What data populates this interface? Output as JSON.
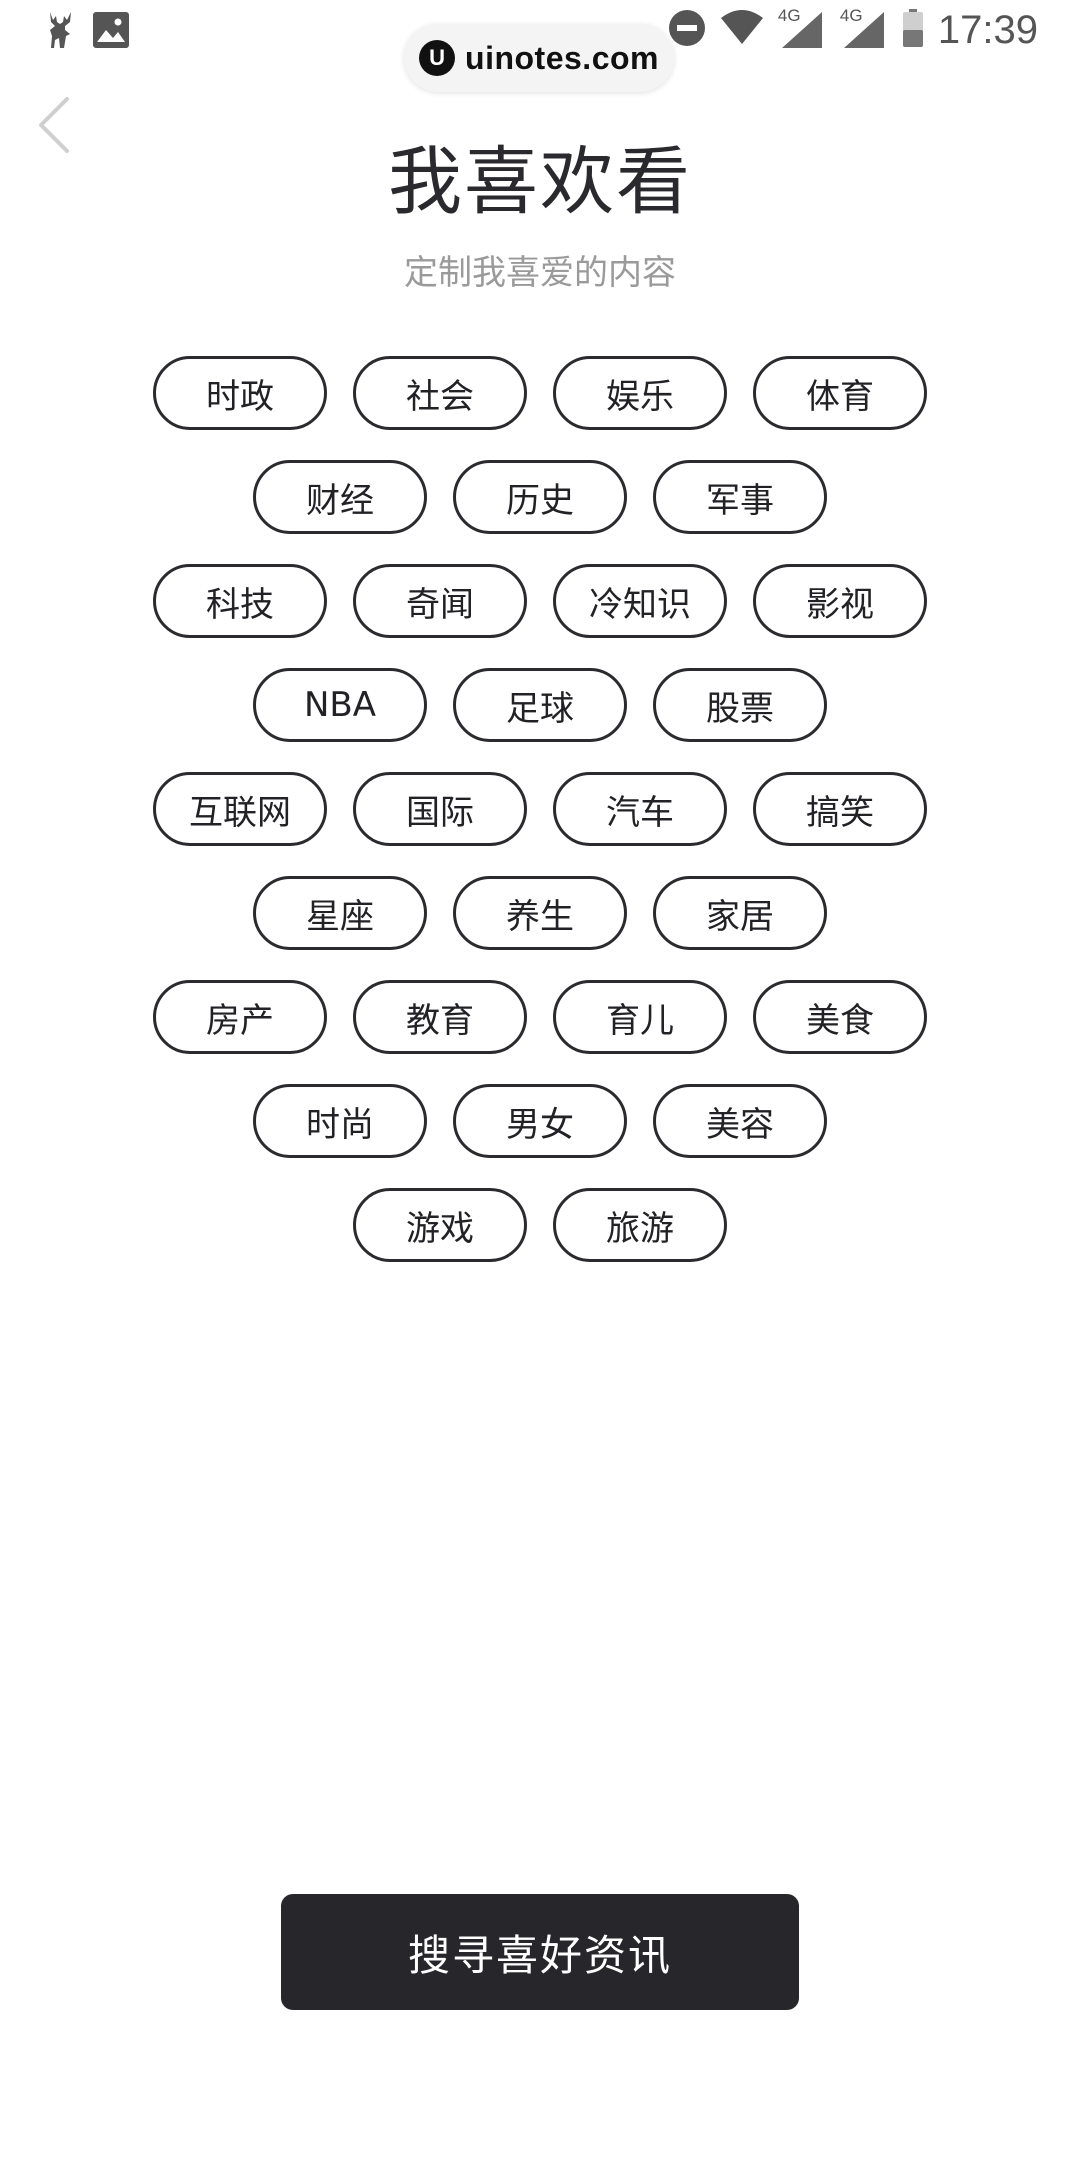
{
  "status_bar": {
    "time": "17:39",
    "network_1": "4G",
    "network_2": "4G",
    "icons": [
      "deer-app-icon",
      "image-icon",
      "do-not-disturb-icon",
      "wifi-icon",
      "signal-icon",
      "signal-icon",
      "battery-icon"
    ]
  },
  "watermark": {
    "logo": "U",
    "text": "uinotes.com"
  },
  "header": {
    "title": "我喜欢看",
    "subtitle": "定制我喜爱的内容",
    "back_icon": "chevron-left-icon"
  },
  "tag_rows": [
    [
      "时政",
      "社会",
      "娱乐",
      "体育"
    ],
    [
      "财经",
      "历史",
      "军事"
    ],
    [
      "科技",
      "奇闻",
      "冷知识",
      "影视"
    ],
    [
      "NBA",
      "足球",
      "股票"
    ],
    [
      "互联网",
      "国际",
      "汽车",
      "搞笑"
    ],
    [
      "星座",
      "养生",
      "家居"
    ],
    [
      "房产",
      "教育",
      "育儿",
      "美食"
    ],
    [
      "时尚",
      "男女",
      "美容"
    ],
    [
      "游戏",
      "旅游"
    ]
  ],
  "search_button": {
    "label": "搜寻喜好资讯"
  },
  "colors": {
    "primary_dark": "#27272b",
    "tag_border": "#2b2b2f",
    "subtitle": "#9a9a9a",
    "background": "#ffffff"
  }
}
